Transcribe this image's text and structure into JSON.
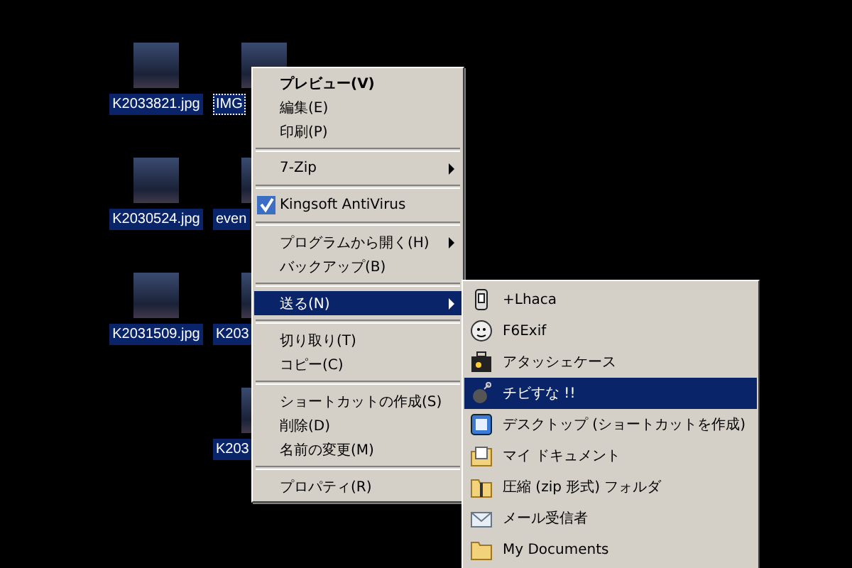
{
  "desktop": {
    "columns": [
      [
        {
          "label": "K2033821.jpg",
          "selected": true,
          "focused": false
        },
        {
          "label": "K2030524.jpg",
          "selected": true,
          "focused": false
        },
        {
          "label": "K2031509.jpg",
          "selected": true,
          "focused": false
        }
      ],
      [
        {
          "label": "IMG",
          "selected": true,
          "focused": true
        },
        {
          "label": "even",
          "selected": true,
          "focused": false
        },
        {
          "label": "K203",
          "selected": true,
          "focused": false
        },
        {
          "label": "K203",
          "selected": true,
          "focused": false
        }
      ]
    ]
  },
  "context_menu": {
    "items": [
      {
        "kind": "command",
        "label": "プレビュー(V)",
        "bold": true,
        "selected": false
      },
      {
        "kind": "command",
        "label": "編集(E)",
        "bold": false,
        "selected": false
      },
      {
        "kind": "command",
        "label": "印刷(P)",
        "bold": false,
        "selected": false
      },
      {
        "kind": "separator"
      },
      {
        "kind": "submenu",
        "label": "7-Zip",
        "bold": false,
        "selected": false
      },
      {
        "kind": "separator"
      },
      {
        "kind": "icon",
        "label": "Kingsoft AntiVirus",
        "bold": false,
        "selected": false
      },
      {
        "kind": "separator"
      },
      {
        "kind": "submenu",
        "label": "プログラムから開く(H)",
        "bold": false,
        "selected": false
      },
      {
        "kind": "command",
        "label": "バックアップ(B)",
        "bold": false,
        "selected": false
      },
      {
        "kind": "separator"
      },
      {
        "kind": "submenu",
        "label": "送る(N)",
        "bold": false,
        "selected": true
      },
      {
        "kind": "separator"
      },
      {
        "kind": "command",
        "label": "切り取り(T)",
        "bold": false,
        "selected": false
      },
      {
        "kind": "command",
        "label": "コピー(C)",
        "bold": false,
        "selected": false
      },
      {
        "kind": "separator"
      },
      {
        "kind": "command",
        "label": "ショートカットの作成(S)",
        "bold": false,
        "selected": false
      },
      {
        "kind": "command",
        "label": "削除(D)",
        "bold": false,
        "selected": false
      },
      {
        "kind": "command",
        "label": "名前の変更(M)",
        "bold": false,
        "selected": false
      },
      {
        "kind": "separator"
      },
      {
        "kind": "command",
        "label": "プロパティ(R)",
        "bold": false,
        "selected": false
      }
    ]
  },
  "send_to_menu": {
    "items": [
      {
        "label": "+Lhaca",
        "selected": false
      },
      {
        "label": "F6Exif",
        "selected": false
      },
      {
        "label": "アタッシェケース",
        "selected": false
      },
      {
        "label": "チビすな !!",
        "selected": true
      },
      {
        "label": "デスクトップ (ショートカットを作成)",
        "selected": false
      },
      {
        "label": "マイ ドキュメント",
        "selected": false
      },
      {
        "label": "圧縮 (zip 形式) フォルダ",
        "selected": false
      },
      {
        "label": "メール受信者",
        "selected": false
      },
      {
        "label": "My Documents",
        "selected": false
      }
    ]
  }
}
